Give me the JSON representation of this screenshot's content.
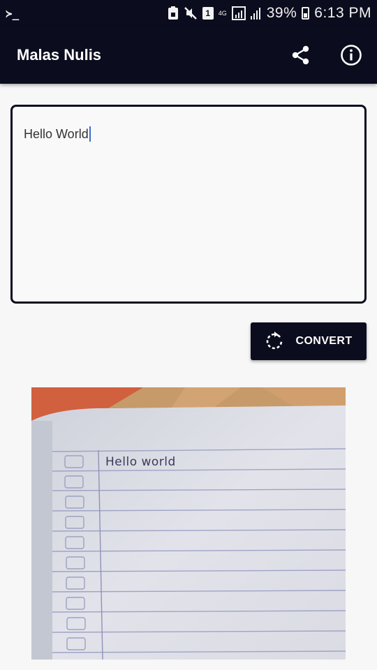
{
  "status_bar": {
    "left_glyph": "≻_",
    "sim_badge": "1",
    "network_type": "4G",
    "battery": "39%",
    "time": "6:13 PM"
  },
  "app_bar": {
    "title": "Malas Nulis",
    "actions": [
      {
        "name": "share",
        "icon": "share-icon"
      },
      {
        "name": "info",
        "icon": "info-icon"
      }
    ]
  },
  "editor": {
    "value": "Hello World"
  },
  "convert_button": {
    "label": "CONVERT",
    "icon": "convert-icon"
  },
  "result": {
    "handwritten_text": "Hello world"
  },
  "colors": {
    "primary": "#0b0c1d",
    "background": "#f7f7f7",
    "caret": "#3b6fd1"
  }
}
